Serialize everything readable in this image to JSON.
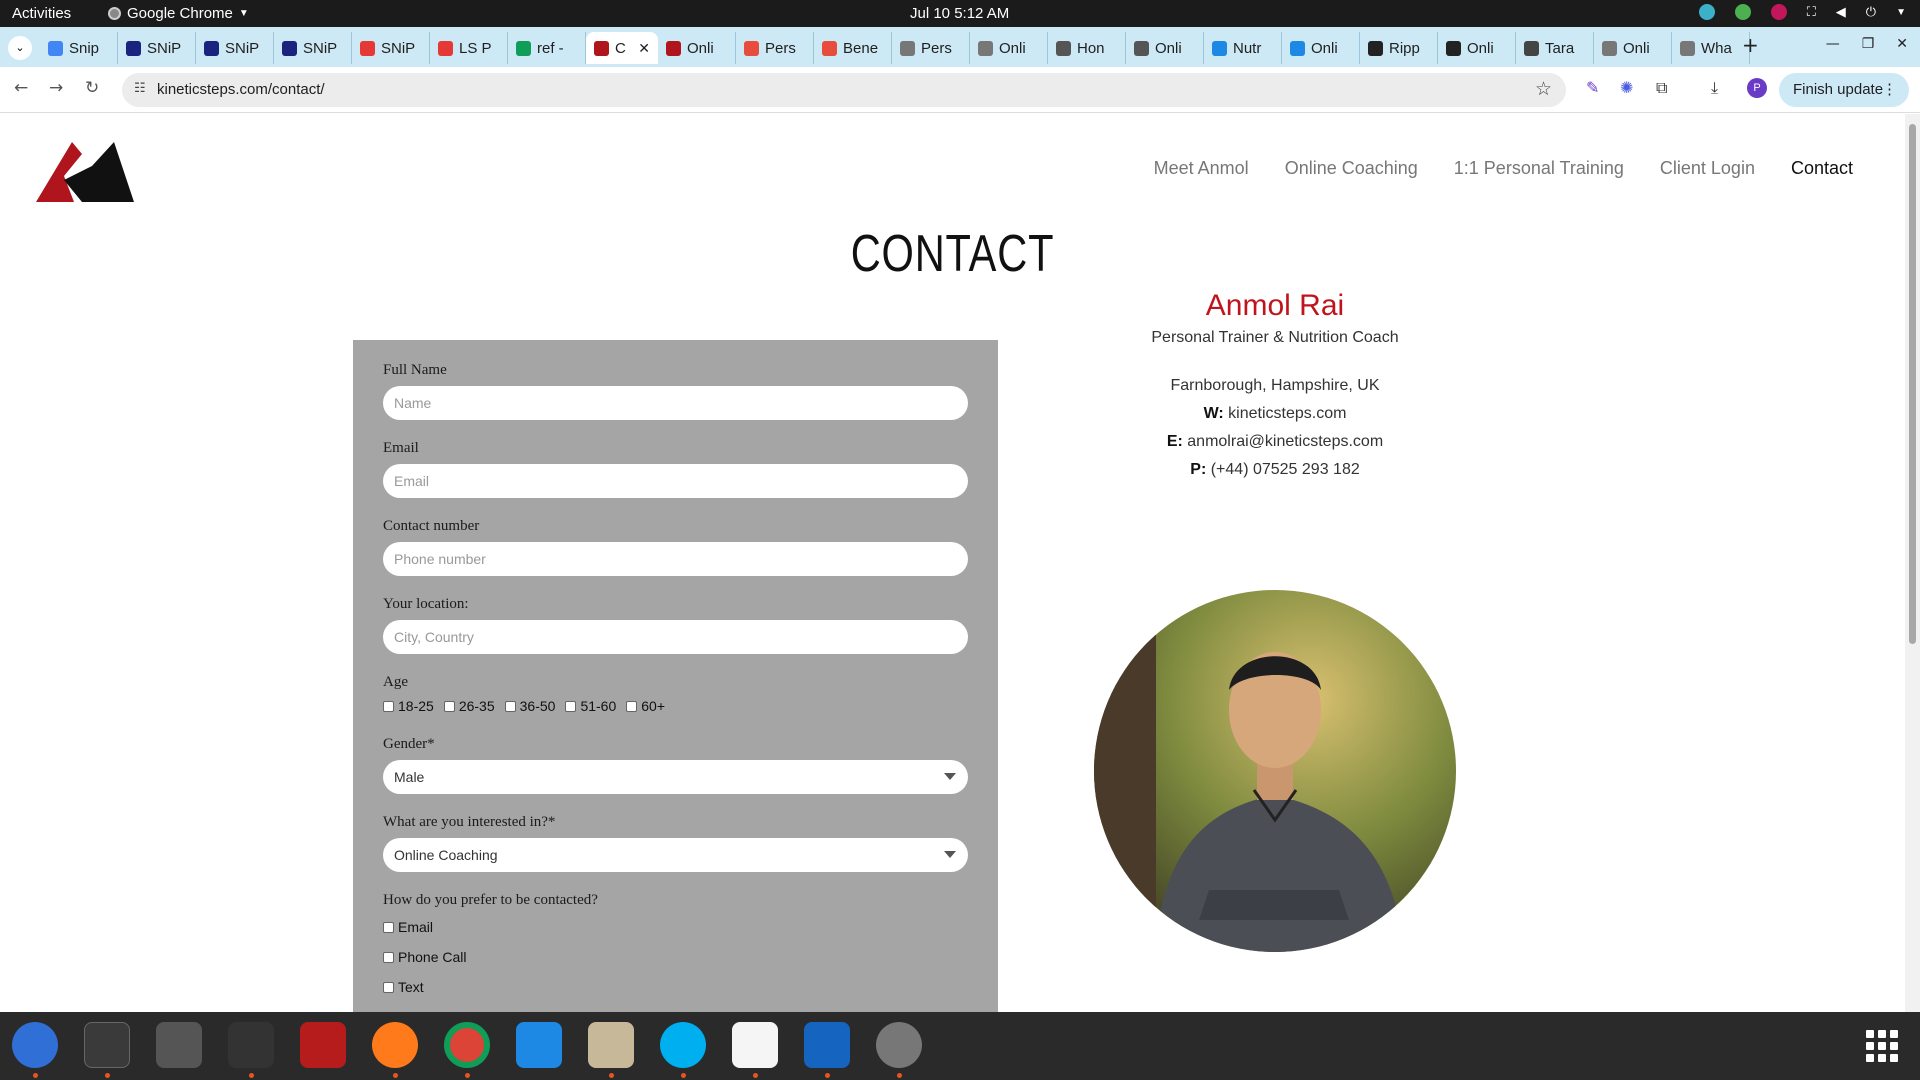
{
  "system": {
    "activities": "Activities",
    "app_name": "Google Chrome",
    "clock": "Jul 10  5:12 AM"
  },
  "tabs": [
    {
      "label": "Snip",
      "color": "#4285f4"
    },
    {
      "label": "SNiP",
      "color": "#1a237e"
    },
    {
      "label": "SNiP",
      "color": "#1a237e"
    },
    {
      "label": "SNiP",
      "color": "#1a237e"
    },
    {
      "label": "SNiP",
      "color": "#e53935"
    },
    {
      "label": "LS P",
      "color": "#e53935"
    },
    {
      "label": "ref -",
      "color": "#0f9d58"
    },
    {
      "label": "C",
      "color": "#b0141c",
      "active": true
    },
    {
      "label": "Onli",
      "color": "#b0141c"
    },
    {
      "label": "Pers",
      "color": "#e74c3c"
    },
    {
      "label": "Bene",
      "color": "#e74c3c"
    },
    {
      "label": "Pers",
      "color": "#777777"
    },
    {
      "label": "Onli",
      "color": "#777777"
    },
    {
      "label": "Hon",
      "color": "#555555"
    },
    {
      "label": "Onli",
      "color": "#555555"
    },
    {
      "label": "Nutr",
      "color": "#1e88e5"
    },
    {
      "label": "Onli",
      "color": "#1e88e5"
    },
    {
      "label": "Ripp",
      "color": "#222222"
    },
    {
      "label": "Onli",
      "color": "#222222"
    },
    {
      "label": "Tara",
      "color": "#444444"
    },
    {
      "label": "Onli",
      "color": "#777777"
    },
    {
      "label": "Wha",
      "color": "#777777"
    }
  ],
  "browser": {
    "url": "kineticsteps.com/contact/",
    "finish_update": "Finish update",
    "profile_initial": "P"
  },
  "site": {
    "nav": [
      "Meet Anmol",
      "Online Coaching",
      "1:1 Personal Training",
      "Client Login",
      "Contact"
    ],
    "page_title": "CONTACT"
  },
  "form": {
    "full_name_label": "Full Name",
    "full_name_placeholder": "Name",
    "email_label": "Email",
    "email_placeholder": "Email",
    "contact_label": "Contact number",
    "contact_placeholder": "Phone number",
    "location_label": "Your location:",
    "location_placeholder": "City, Country",
    "age_label": "Age",
    "age_options": [
      "18-25",
      "26-35",
      "36-50",
      "51-60",
      "60+"
    ],
    "gender_label": "Gender*",
    "gender_value": "Male",
    "interest_label": "What are you interested in?*",
    "interest_value": "Online Coaching",
    "contact_pref_label": "How do you prefer to be contacted?",
    "contact_pref_options": [
      "Email",
      "Phone Call",
      "Text"
    ]
  },
  "card": {
    "name": "Anmol Rai",
    "role": "Personal Trainer & Nutrition Coach",
    "address": "Farnborough, Hampshire, UK",
    "w_label": "W:",
    "website": "kineticsteps.com",
    "e_label": "E:",
    "email": "anmolrai@kineticsteps.com",
    "p_label": "P:",
    "phone": "(+44) 07525 293 182"
  }
}
